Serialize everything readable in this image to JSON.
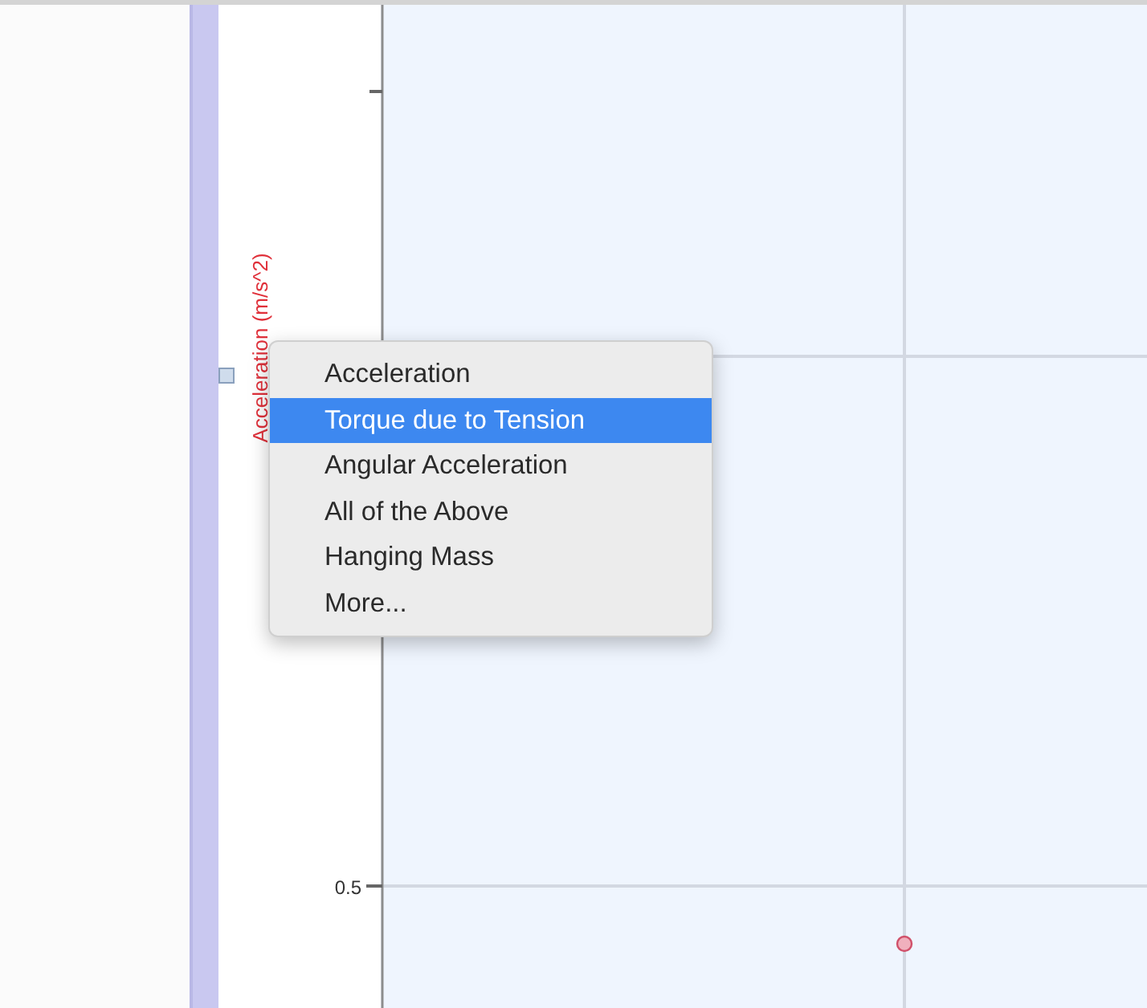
{
  "graph": {
    "y_axis_label": "Acceleration (m/s^2)",
    "tick_labels": [
      "0.5"
    ]
  },
  "context_menu": {
    "items": [
      {
        "label": "Acceleration",
        "selected": false
      },
      {
        "label": "Torque due to Tension",
        "selected": true
      },
      {
        "label": "Angular Acceleration",
        "selected": false
      },
      {
        "label": "All of the Above",
        "selected": false
      },
      {
        "label": "Hanging Mass",
        "selected": false
      },
      {
        "label": "More...",
        "selected": false
      }
    ]
  }
}
